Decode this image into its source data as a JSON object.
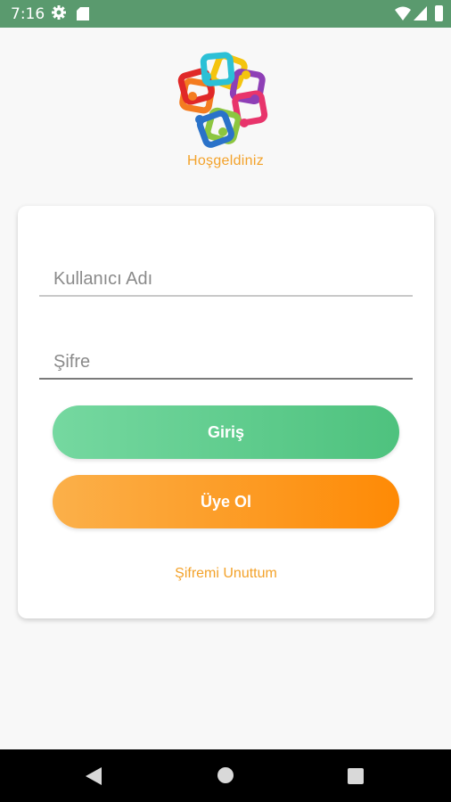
{
  "status_bar": {
    "time": "7:16"
  },
  "header": {
    "welcome_text": "Hoşgeldiniz"
  },
  "login_form": {
    "username_placeholder": "Kullanıcı Adı",
    "password_placeholder": "Şifre",
    "login_button_label": "Giriş",
    "register_button_label": "Üye Ol",
    "forgot_password_label": "Şifremi Unuttum"
  },
  "colors": {
    "status_bar": "#5a9a6e",
    "accent_orange": "#f3a22a",
    "login_green": "#4ec27e",
    "register_orange": "#fe8a05"
  },
  "icons": {
    "status": [
      "gear-icon",
      "sd-card-icon",
      "wifi-icon",
      "signal-icon",
      "battery-icon"
    ],
    "nav": [
      "back-icon",
      "home-icon",
      "recent-apps-icon"
    ]
  }
}
